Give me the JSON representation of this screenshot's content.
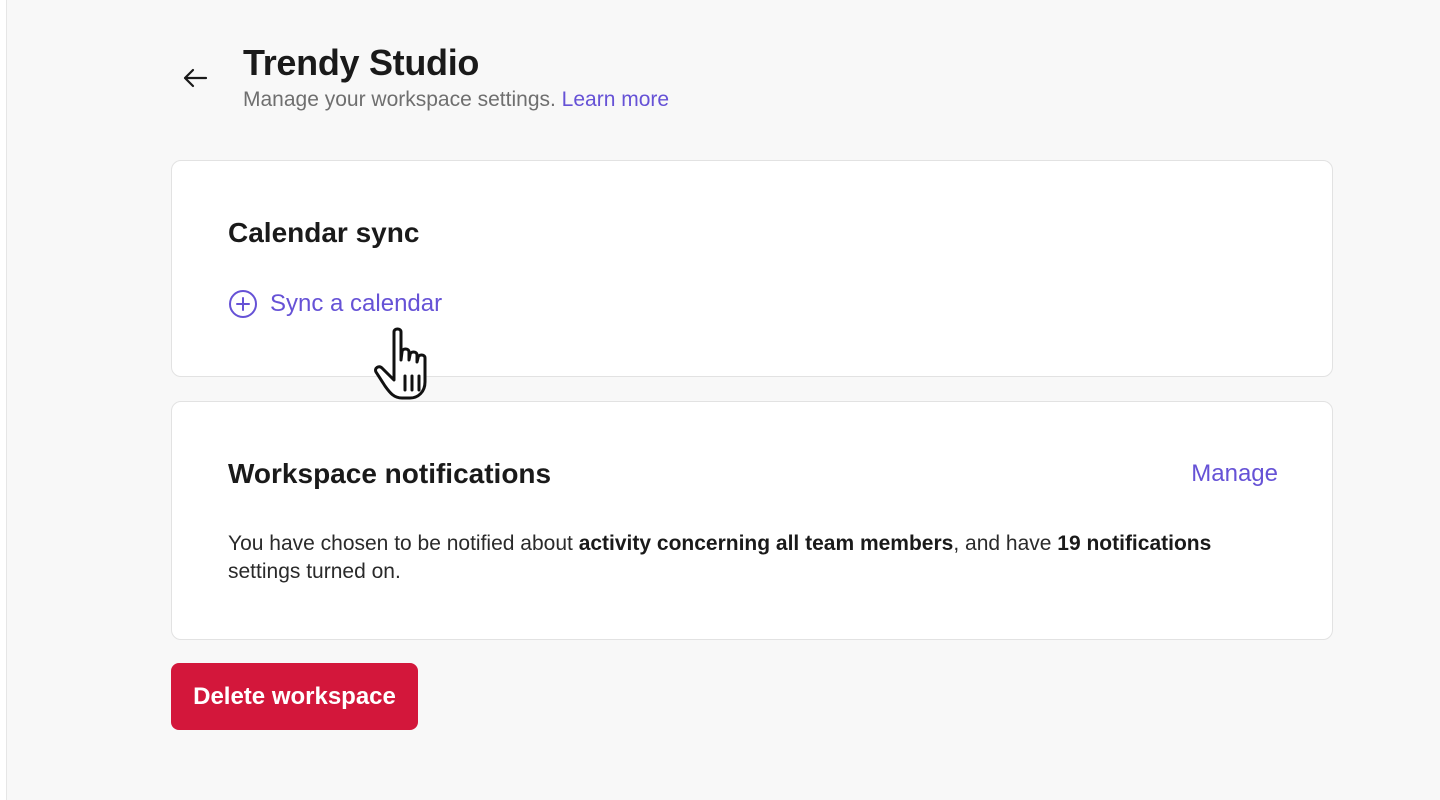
{
  "header": {
    "back_icon": "arrow-left-icon",
    "title": "Trendy Studio",
    "subtitle": "Manage your workspace settings.",
    "learn_more": "Learn more"
  },
  "calendar_sync": {
    "heading": "Calendar sync",
    "add_icon": "plus-circle-icon",
    "sync_label": "Sync a calendar"
  },
  "notifications": {
    "heading": "Workspace notifications",
    "manage_label": "Manage",
    "text_part1": "You have chosen to be notified about ",
    "text_bold1": "activity concerning all team members",
    "text_part2": ", and have ",
    "text_bold2": "19 notifications",
    "text_part3": " settings turned on."
  },
  "actions": {
    "delete_label": "Delete workspace"
  },
  "colors": {
    "accent": "#6652d6",
    "danger": "#d3173b",
    "background": "#f8f8f8",
    "card": "#ffffff"
  },
  "cursor_icon": "hand-pointer-icon"
}
